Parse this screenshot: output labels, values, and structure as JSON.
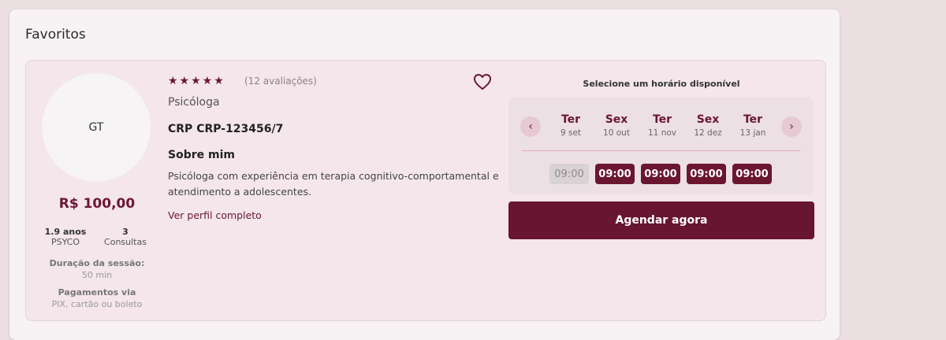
{
  "page": {
    "title": "Favoritos"
  },
  "professional": {
    "initials": "GT",
    "price": "R$ 100,00",
    "stats": [
      {
        "value": "1.9 anos",
        "label": "PSYCO"
      },
      {
        "value": "3",
        "label": "Consultas"
      }
    ],
    "session": {
      "label": "Duração da sessão:",
      "value": "50 min"
    },
    "payments": {
      "label": "Pagamentos via",
      "value": "PIX, cartão ou boleto"
    },
    "stars": "★★★★★",
    "rating_count": 5,
    "reviews": "(12 avaliações)",
    "role": "Psicóloga",
    "crp": "CRP CRP-123456/7",
    "about_title": "Sobre mim",
    "about_text": "Psicóloga com experiência em terapia cognitivo-comportamental e atendimento a adolescentes.",
    "profile_link": "Ver perfil completo"
  },
  "schedule": {
    "label": "Selecione um horário disponível",
    "prev_icon": "‹",
    "next_icon": "›",
    "days": [
      {
        "name": "Ter",
        "date": "9 set"
      },
      {
        "name": "Sex",
        "date": "10 out"
      },
      {
        "name": "Ter",
        "date": "11 nov"
      },
      {
        "name": "Sex",
        "date": "12 dez"
      },
      {
        "name": "Ter",
        "date": "13 jan"
      }
    ],
    "slots": [
      {
        "time": "09:00",
        "available": false
      },
      {
        "time": "09:00",
        "available": true
      },
      {
        "time": "09:00",
        "available": true
      },
      {
        "time": "09:00",
        "available": true
      },
      {
        "time": "09:00",
        "available": true
      }
    ],
    "book_label": "Agendar agora"
  },
  "colors": {
    "accent": "#6b1631",
    "card_bg": "#f4e6ea",
    "page_bg": "#ebdfe2"
  }
}
